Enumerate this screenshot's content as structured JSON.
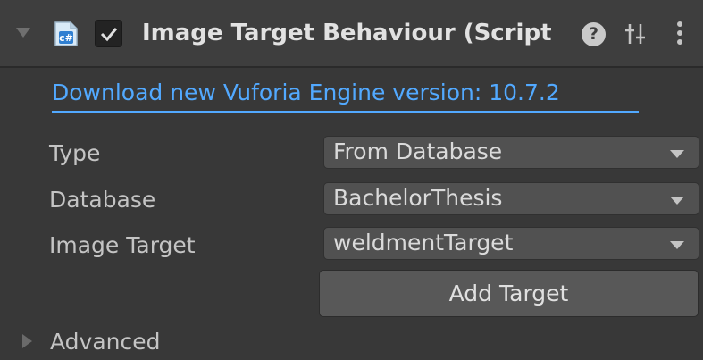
{
  "header": {
    "title": "Image Target Behaviour (Script",
    "enabled": true,
    "icons": {
      "foldout": "foldout-expanded-icon",
      "script": "csharp-script-icon",
      "help": "help-icon",
      "presets": "presets-icon",
      "menu": "kebab-menu-icon"
    },
    "help_glyph": "?"
  },
  "update_link": "Download new Vuforia Engine version: 10.7.2",
  "properties": [
    {
      "label": "Type",
      "value": "From Database"
    },
    {
      "label": "Database",
      "value": "BachelorThesis"
    },
    {
      "label": "Image Target",
      "value": "weldmentTarget"
    }
  ],
  "add_target_label": "Add Target",
  "advanced_label": "Advanced",
  "colors": {
    "background": "#383838",
    "header": "#3e3e3e",
    "link": "#52a9ff",
    "dropdown": "#515151",
    "button": "#585858",
    "text": "#c4c4c4"
  }
}
